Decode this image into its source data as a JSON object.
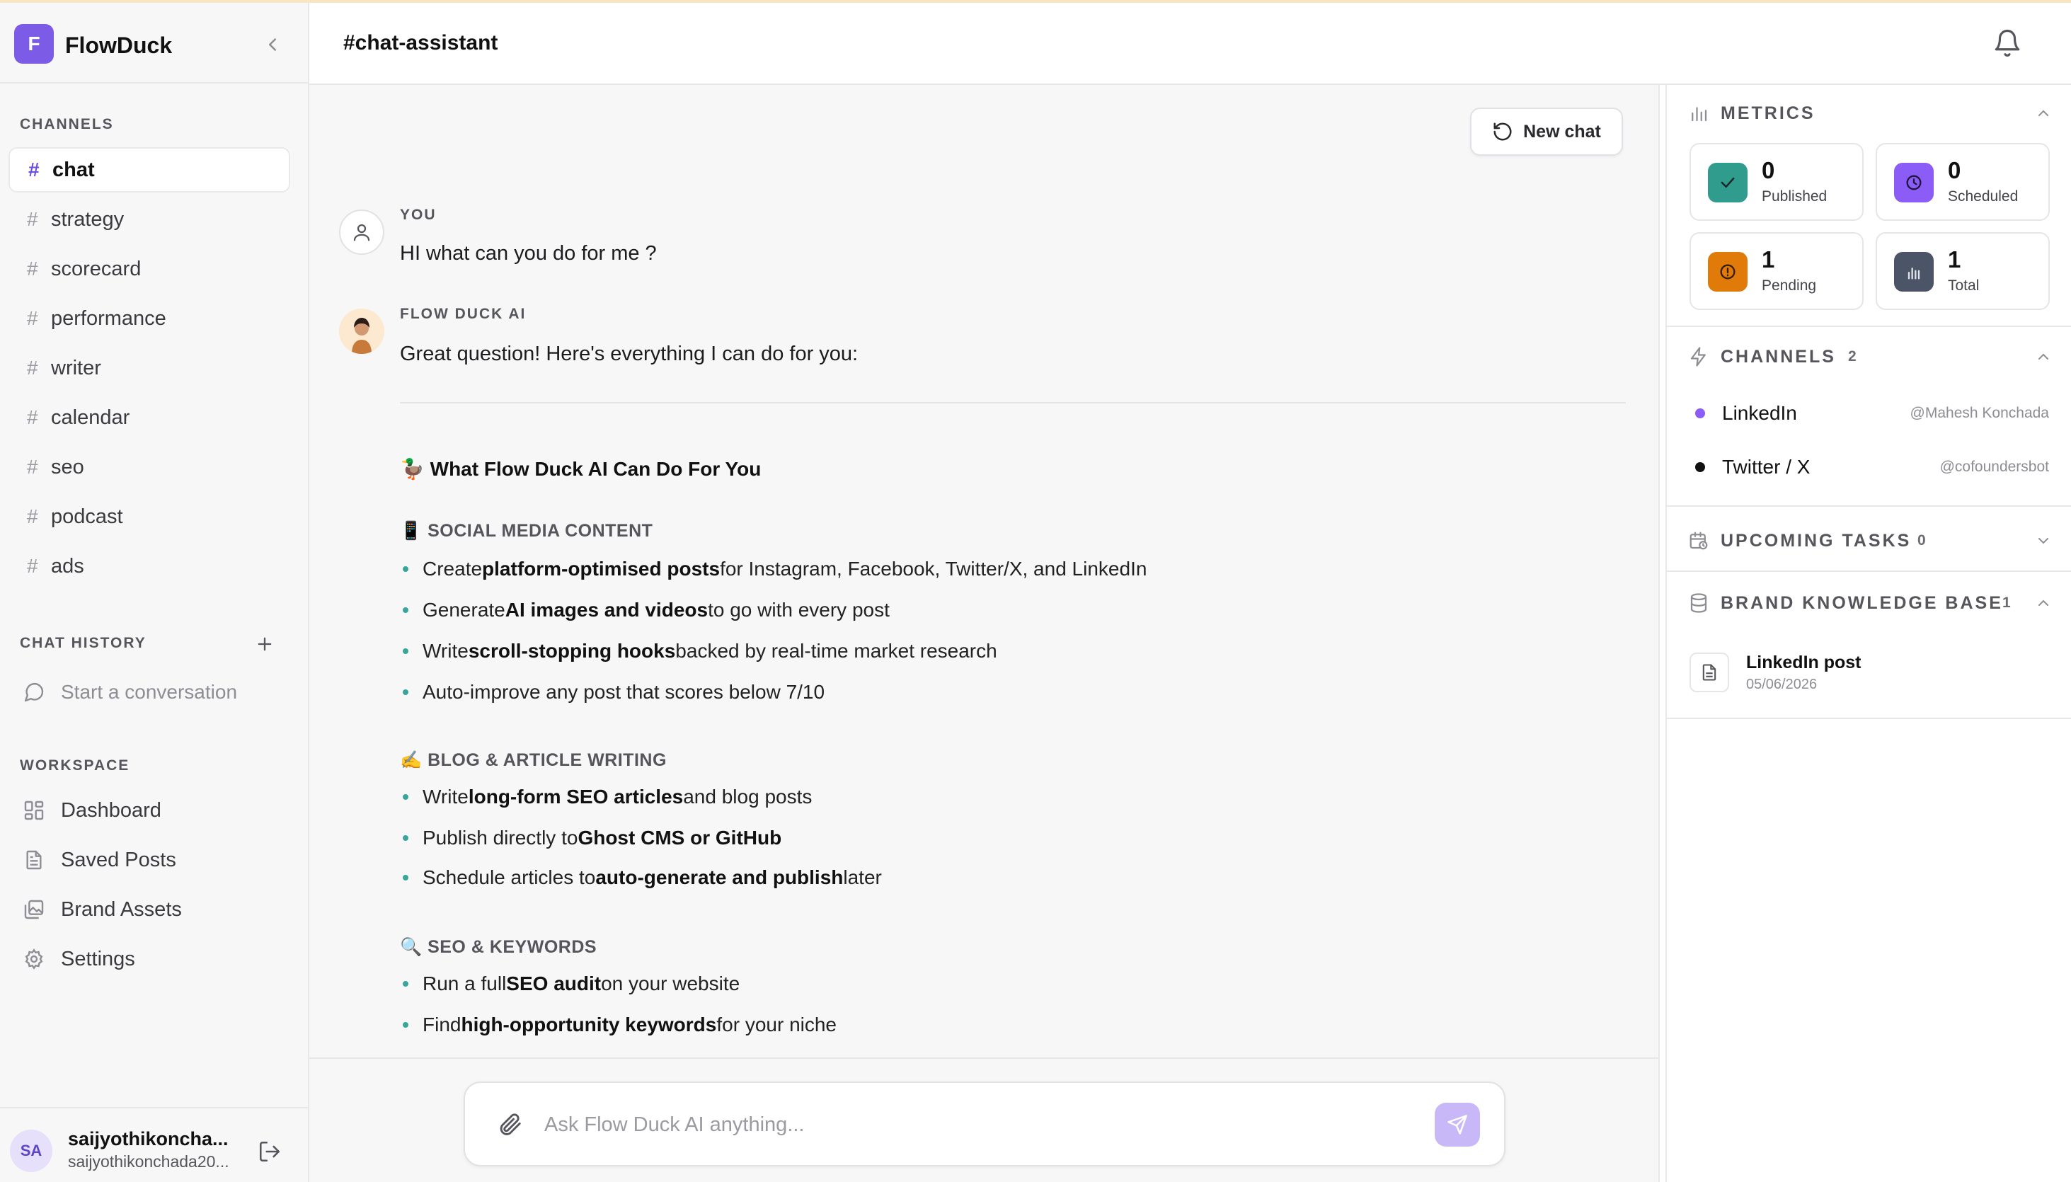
{
  "brand": {
    "logo_letter": "F",
    "name": "FlowDuck"
  },
  "sidebar": {
    "channels_label": "CHANNELS",
    "channels": [
      {
        "label": "chat",
        "active": true
      },
      {
        "label": "strategy"
      },
      {
        "label": "scorecard"
      },
      {
        "label": "performance"
      },
      {
        "label": "writer"
      },
      {
        "label": "calendar"
      },
      {
        "label": "seo"
      },
      {
        "label": "podcast"
      },
      {
        "label": "ads"
      }
    ],
    "hash": "#",
    "history_label": "CHAT HISTORY",
    "history_empty": "Start a conversation",
    "workspace_label": "WORKSPACE",
    "workspace": [
      {
        "label": "Dashboard",
        "icon": "dashboard-icon"
      },
      {
        "label": "Saved Posts",
        "icon": "document-icon"
      },
      {
        "label": "Brand Assets",
        "icon": "image-icon"
      },
      {
        "label": "Settings",
        "icon": "gear-icon"
      }
    ],
    "user": {
      "initials": "SA",
      "name": "saijyothikoncha...",
      "email": "saijyothikonchada20..."
    }
  },
  "header": {
    "title": "#chat-assistant"
  },
  "chat": {
    "new_chat_label": "New chat",
    "user_role": "YOU",
    "user_message": "HI what can you do for me ?",
    "ai_role": "FLOW DUCK AI",
    "ai_intro": "Great question! Here's everything I can do for you:",
    "ai_heading": "🦆 What Flow Duck AI Can Do For You",
    "sections": [
      {
        "title": "📱 SOCIAL MEDIA CONTENT",
        "bullets": [
          {
            "pre": "Create ",
            "bold": "platform-optimised posts",
            "post": " for Instagram, Facebook, Twitter/X, and LinkedIn"
          },
          {
            "pre": "Generate ",
            "bold": "AI images and videos",
            "post": " to go with every post"
          },
          {
            "pre": "Write ",
            "bold": "scroll-stopping hooks",
            "post": " backed by real-time market research"
          },
          {
            "pre": "Auto-improve any post that scores below 7/10",
            "bold": "",
            "post": ""
          }
        ]
      },
      {
        "title": "✍️ BLOG & ARTICLE WRITING",
        "bullets": [
          {
            "pre": "Write ",
            "bold": "long-form SEO articles",
            "post": " and blog posts"
          },
          {
            "pre": "Publish directly to ",
            "bold": "Ghost CMS or GitHub",
            "post": ""
          },
          {
            "pre": "Schedule articles to ",
            "bold": "auto-generate and publish",
            "post": " later"
          }
        ]
      },
      {
        "title": "🔍 SEO & KEYWORDS",
        "bullets": [
          {
            "pre": "Run a full ",
            "bold": "SEO audit",
            "post": " on your website"
          },
          {
            "pre": "Find ",
            "bold": "high-opportunity keywords",
            "post": " for your niche"
          }
        ]
      }
    ],
    "composer_placeholder": "Ask Flow Duck AI anything..."
  },
  "right_panel": {
    "metrics_title": "METRICS",
    "metrics": [
      {
        "value": "0",
        "label": "Published",
        "color": "#2f9c8d",
        "icon": "check-icon"
      },
      {
        "value": "0",
        "label": "Scheduled",
        "color": "#8b5cf6",
        "icon": "clock-icon"
      },
      {
        "value": "1",
        "label": "Pending",
        "color": "#e07b0a",
        "icon": "alert-icon"
      },
      {
        "value": "1",
        "label": "Total",
        "color": "#4b5567",
        "icon": "bar-chart-icon"
      }
    ],
    "channels_title": "CHANNELS",
    "channels_count": "2",
    "connections": [
      {
        "name": "LinkedIn",
        "handle": "@Mahesh Konchada",
        "color": "#8b5cf6"
      },
      {
        "name": "Twitter / X",
        "handle": "@cofoundersbot",
        "color": "#111111"
      }
    ],
    "tasks_title": "UPCOMING TASKS",
    "tasks_count": "0",
    "kb_title": "BRAND KNOWLEDGE BASE",
    "kb_count": "1",
    "kb_items": [
      {
        "name": "LinkedIn post",
        "date": "05/06/2026"
      }
    ]
  }
}
